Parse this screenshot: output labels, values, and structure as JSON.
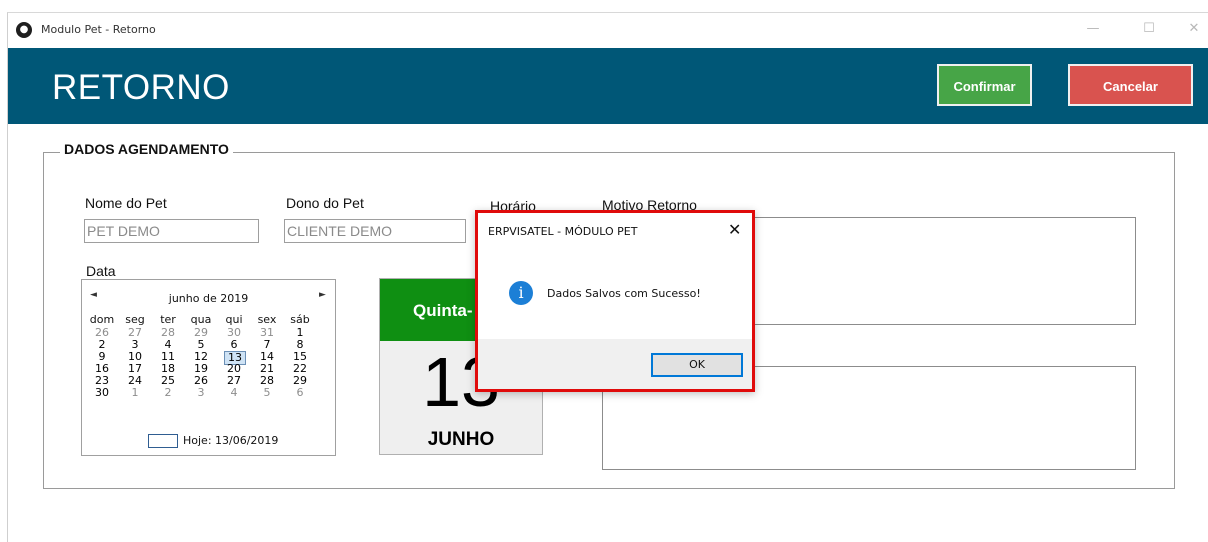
{
  "window": {
    "title": "Modulo Pet - Retorno",
    "controls": {
      "minimize": "—",
      "maximize": "☐",
      "close": "✕"
    }
  },
  "header": {
    "title": "RETORNO",
    "confirm_label": "Confirmar",
    "cancel_label": "Cancelar"
  },
  "form": {
    "group_title": "DADOS AGENDAMENTO",
    "pet_label": "Nome do Pet",
    "pet_value": "PET DEMO",
    "owner_label": "Dono do Pet",
    "owner_value": "CLIENTE DEMO",
    "time_label": "Horário",
    "reason_label": "Motivo Retorno",
    "date_label": "Data"
  },
  "calendar": {
    "prev": "◄",
    "next": "►",
    "month_label": "junho de 2019",
    "weekdays": [
      "dom",
      "seg",
      "ter",
      "qua",
      "qui",
      "sex",
      "sáb"
    ],
    "weeks": [
      [
        "26",
        "27",
        "28",
        "29",
        "30",
        "31",
        "1"
      ],
      [
        "2",
        "3",
        "4",
        "5",
        "6",
        "7",
        "8"
      ],
      [
        "9",
        "10",
        "11",
        "12",
        "13",
        "14",
        "15"
      ],
      [
        "16",
        "17",
        "18",
        "19",
        "20",
        "21",
        "22"
      ],
      [
        "23",
        "24",
        "25",
        "26",
        "27",
        "28",
        "29"
      ],
      [
        "30",
        "1",
        "2",
        "3",
        "4",
        "5",
        "6"
      ]
    ],
    "selected_day": "13",
    "today_label": "Hoje: 13/06/2019"
  },
  "daycard": {
    "weekday": "Quinta-",
    "day": "13",
    "month": "JUNHO"
  },
  "dialog": {
    "title": "ERPVISATEL - MÓDULO PET",
    "close": "✕",
    "icon": "i",
    "message": "Dados Salvos com Sucesso!",
    "ok_label": "OK"
  },
  "colors": {
    "header_bg": "#005777",
    "confirm_bg": "#47a547",
    "cancel_bg": "#d9534f",
    "daycard_top": "#0f8f12",
    "dialog_border": "#e00b0b",
    "info_icon": "#1c7fd6"
  }
}
